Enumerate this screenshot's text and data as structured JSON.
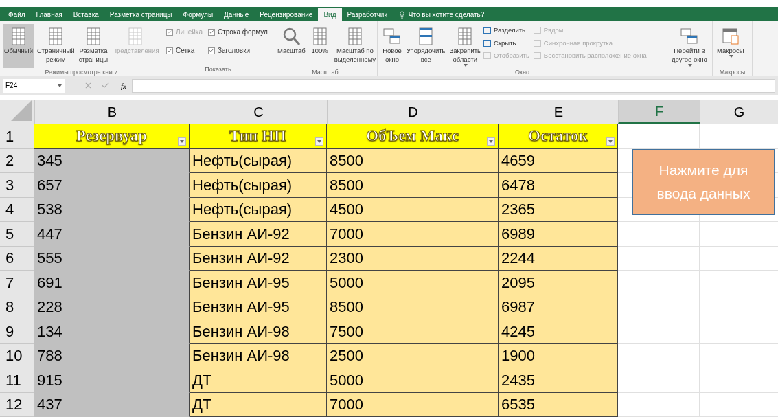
{
  "tabs": [
    {
      "label": "Файл",
      "selected": false
    },
    {
      "label": "Главная",
      "selected": false
    },
    {
      "label": "Вставка",
      "selected": false
    },
    {
      "label": "Разметка страницы",
      "selected": false
    },
    {
      "label": "Формулы",
      "selected": false
    },
    {
      "label": "Данные",
      "selected": false
    },
    {
      "label": "Рецензирование",
      "selected": false
    },
    {
      "label": "Вид",
      "selected": true
    },
    {
      "label": "Разработчик",
      "selected": false
    }
  ],
  "tell_me": "Что вы хотите сделать?",
  "ribbon": {
    "views": {
      "label": "Режимы просмотра книги",
      "buttons": [
        {
          "label": "Обычный",
          "selected": true,
          "disabled": false
        },
        {
          "label": "Страничный\nрежим",
          "selected": false,
          "disabled": false
        },
        {
          "label": "Разметка\nстраницы",
          "selected": false,
          "disabled": false
        },
        {
          "label": "Представления",
          "selected": false,
          "disabled": true
        }
      ]
    },
    "show": {
      "label": "Показать",
      "checkboxes": [
        {
          "label": "Линейка",
          "checked": true,
          "disabled": true
        },
        {
          "label": "Строка формул",
          "checked": true,
          "disabled": false
        },
        {
          "label": "Сетка",
          "checked": true,
          "disabled": false
        },
        {
          "label": "Заголовки",
          "checked": true,
          "disabled": false
        }
      ]
    },
    "zoom": {
      "label": "Масштаб",
      "buttons": [
        {
          "label": "Масштаб"
        },
        {
          "label": "100%"
        },
        {
          "label": "Масштаб по\nвыделенному"
        }
      ]
    },
    "window": {
      "label": "Окно",
      "buttons": [
        {
          "label": "Новое\nокно",
          "dropdown": false
        },
        {
          "label": "Упорядочить\nвсе",
          "dropdown": false
        },
        {
          "label": "Закрепить\nобласти",
          "dropdown": true
        }
      ],
      "small": [
        {
          "label": "Разделить",
          "disabled": false
        },
        {
          "label": "Скрыть",
          "disabled": false
        },
        {
          "label": "Отобразить",
          "disabled": true
        }
      ],
      "small2": [
        {
          "label": "Рядом",
          "disabled": true
        },
        {
          "label": "Синхронная прокрутка",
          "disabled": true
        },
        {
          "label": "Восстановить расположение окна",
          "disabled": true
        }
      ],
      "switch": {
        "label": "Перейти в\nдругое окно",
        "dropdown": true
      }
    },
    "macros": {
      "label": "Макросы",
      "button": {
        "label": "Макросы",
        "dropdown": true
      }
    }
  },
  "formula_bar": {
    "name_box": "F24",
    "fx": "fx"
  },
  "sheet": {
    "columns": [
      {
        "label": "B",
        "selected": false
      },
      {
        "label": "C",
        "selected": false
      },
      {
        "label": "D",
        "selected": false
      },
      {
        "label": "E",
        "selected": false
      },
      {
        "label": "F",
        "selected": true
      },
      {
        "label": "G",
        "selected": false
      }
    ],
    "headers": [
      "Резервуар",
      "Тип НП",
      "ОбЪем Макс",
      "Остаток"
    ],
    "rows": [
      {
        "n": "2",
        "cells": [
          "345",
          "Нефть(сырая)",
          "8500",
          "4659"
        ]
      },
      {
        "n": "3",
        "cells": [
          "657",
          "Нефть(сырая)",
          "8500",
          "6478"
        ]
      },
      {
        "n": "4",
        "cells": [
          "538",
          "Нефть(сырая)",
          "4500",
          "2365"
        ]
      },
      {
        "n": "5",
        "cells": [
          "447",
          "Бензин АИ-92",
          "7000",
          "6989"
        ]
      },
      {
        "n": "6",
        "cells": [
          "555",
          "Бензин АИ-92",
          "2300",
          "2244"
        ]
      },
      {
        "n": "7",
        "cells": [
          "691",
          "Бензин АИ-95",
          "5000",
          "2095"
        ]
      },
      {
        "n": "8",
        "cells": [
          "228",
          "Бензин АИ-95",
          "8500",
          "6987"
        ]
      },
      {
        "n": "9",
        "cells": [
          "134",
          "Бензин АИ-98",
          "7500",
          "4245"
        ]
      },
      {
        "n": "10",
        "cells": [
          "788",
          "Бензин АИ-98",
          "2500",
          "1900"
        ]
      },
      {
        "n": "11",
        "cells": [
          "915",
          "ДТ",
          "5000",
          "2435"
        ]
      },
      {
        "n": "12",
        "cells": [
          "437",
          "ДТ",
          "7000",
          "6535"
        ]
      }
    ],
    "header_row_number": "1",
    "shape_button": "Нажмите для\nввода данных"
  }
}
